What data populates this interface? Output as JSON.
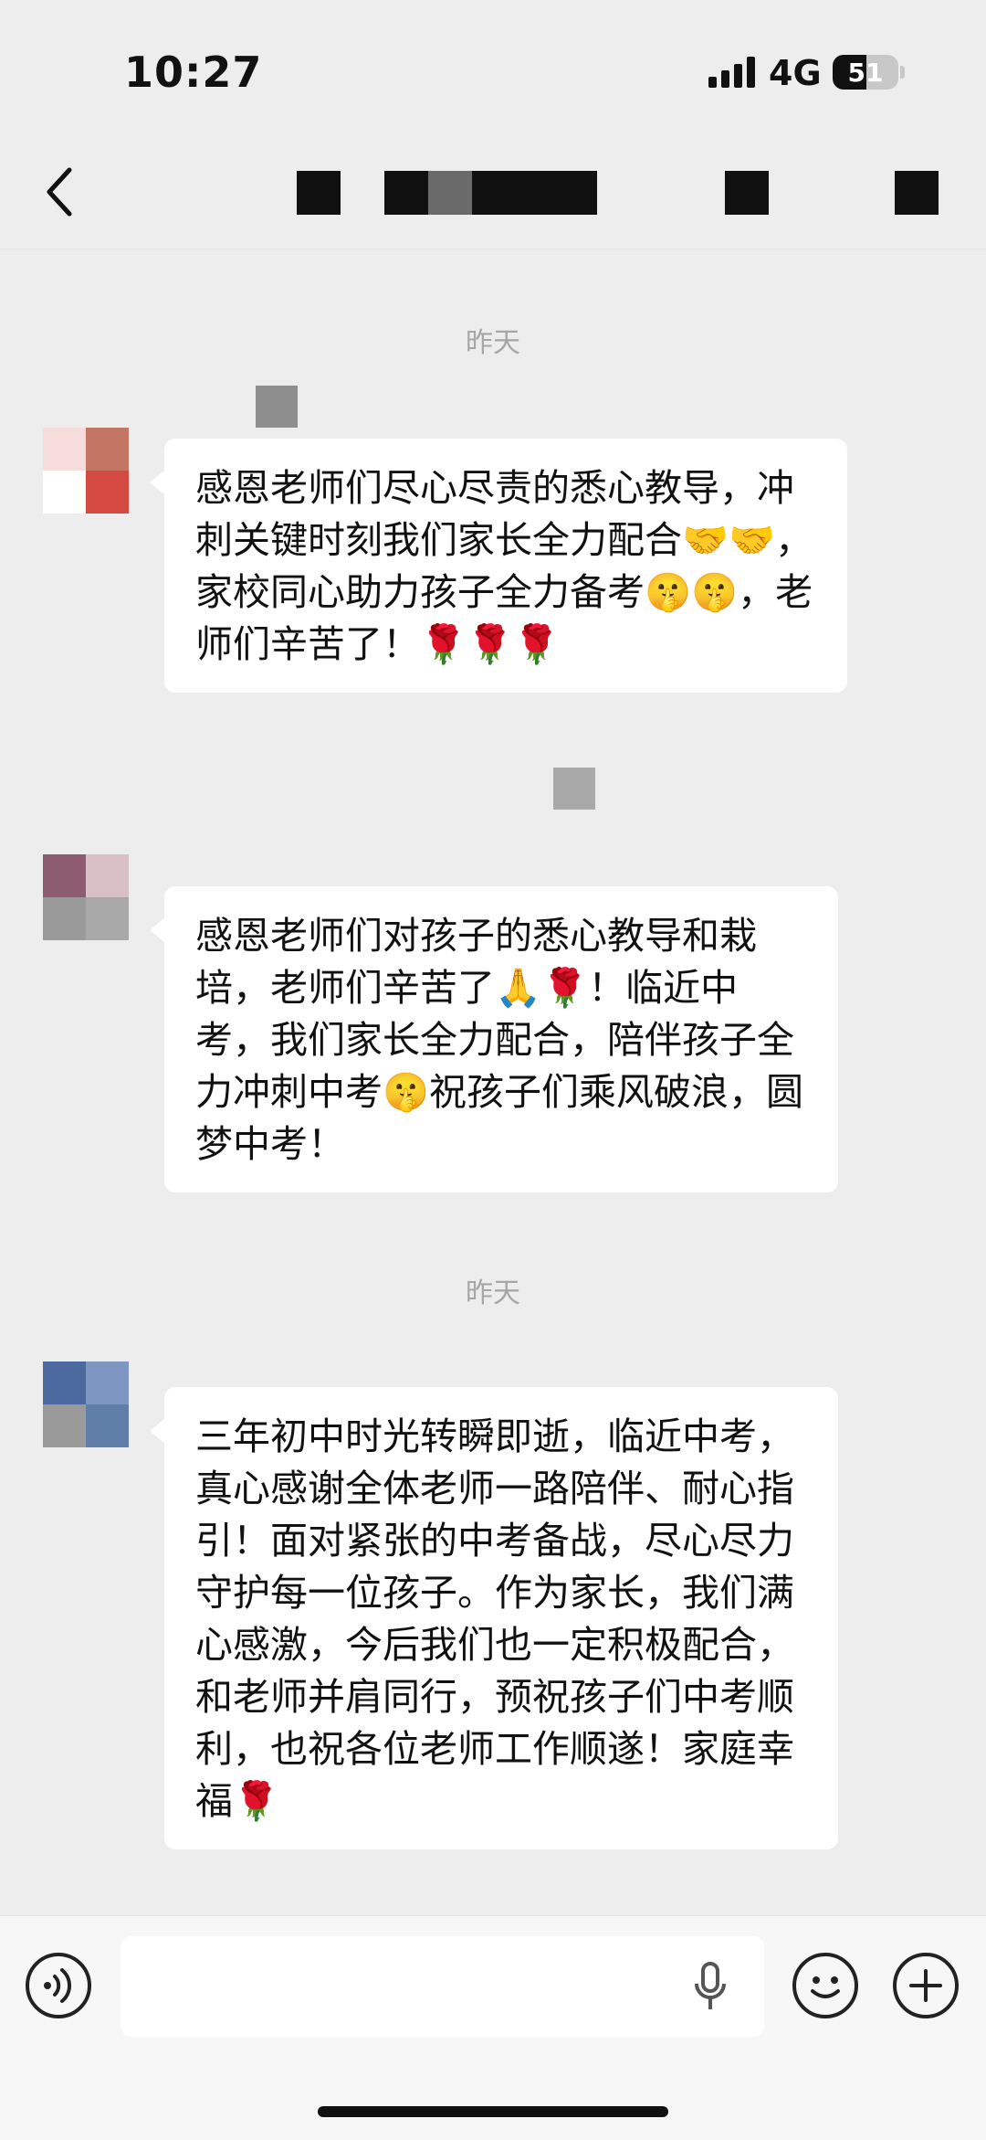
{
  "status_bar": {
    "time": "10:27",
    "network": "4G",
    "battery": "51"
  },
  "colors": {
    "background": "#ededed",
    "bubble": "#ffffff",
    "redaction": "#111111"
  },
  "nav": {
    "back_icon": "chevron-left-icon"
  },
  "chat": {
    "timestamps": [
      "昨天",
      "昨天"
    ],
    "messages": [
      {
        "text": "感恩老师们尽心尽责的悉心教导，冲刺关键时刻我们家长全力配合🤝🤝，家校同心助力孩子全力备考🤫🤫，老师们辛苦了！🌹🌹🌹"
      },
      {
        "text": "感恩老师们对孩子的悉心教导和栽培，老师们辛苦了🙏🌹！临近中考，我们家长全力配合，陪伴孩子全力冲刺中考🤫祝孩子们乘风破浪，圆梦中考！"
      },
      {
        "text": "三年初中时光转瞬即逝，临近中考，真心感谢全体老师一路陪伴、耐心指引！面对紧张的中考备战，尽心尽力守护每一位孩子。作为家长，我们满心感激，今后我们也一定积极配合，和老师并肩同行，预祝孩子们中考顺利，也祝各位老师工作顺遂！家庭幸福🌹"
      }
    ]
  },
  "input_bar": {
    "voice_icon": "voice-icon",
    "mic_icon": "microphone-icon",
    "emoji_icon": "emoji-icon",
    "add_icon": "plus-icon"
  }
}
